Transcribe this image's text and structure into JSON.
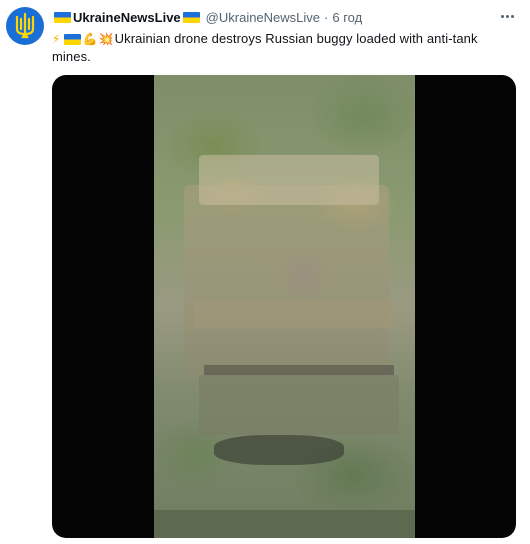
{
  "tweet": {
    "display_name": "UkraineNewsLive",
    "handle": "@UkraineNewsLive",
    "separator": "·",
    "time": "6 год",
    "text": "Ukrainian drone destroys Russian buggy loaded with anti-tank mines.",
    "emojis": [
      "high-voltage",
      "ukraine-flag",
      "flexed-biceps",
      "collision"
    ],
    "media": {
      "type": "video"
    }
  },
  "colors": {
    "flag_blue": "#1e6fdc",
    "flag_yellow": "#ffd700",
    "text": "#0f1419",
    "secondary": "#536471"
  }
}
